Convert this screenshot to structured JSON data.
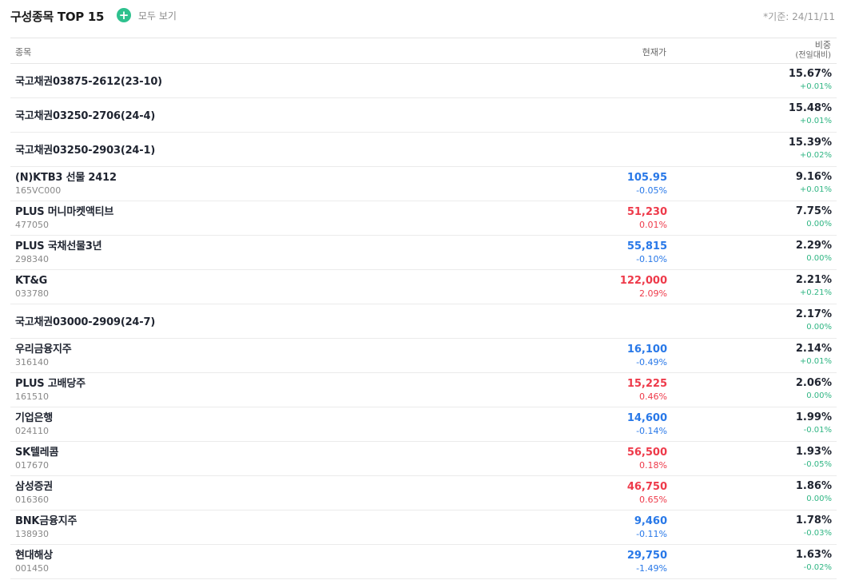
{
  "header": {
    "title": "구성종목 TOP 15",
    "view_all_label": "모두 보기",
    "basis": "*기준: 24/11/11",
    "accent_color": "#2ec18e"
  },
  "table": {
    "columns": {
      "name": "종목",
      "price": "현재가",
      "weight": "비중",
      "weight_sub": "(전일대비)"
    },
    "rows": [
      {
        "name": "국고채권03875-2612(23-10)",
        "code": "",
        "price": "",
        "price_change": "",
        "direction": "",
        "weight": "15.67%",
        "weight_change": "+0.01%"
      },
      {
        "name": "국고채권03250-2706(24-4)",
        "code": "",
        "price": "",
        "price_change": "",
        "direction": "",
        "weight": "15.48%",
        "weight_change": "+0.01%"
      },
      {
        "name": "국고채권03250-2903(24-1)",
        "code": "",
        "price": "",
        "price_change": "",
        "direction": "",
        "weight": "15.39%",
        "weight_change": "+0.02%"
      },
      {
        "name": "(N)KTB3 선물 2412",
        "code": "165VC000",
        "price": "105.95",
        "price_change": "-0.05%",
        "direction": "down",
        "weight": "9.16%",
        "weight_change": "+0.01%"
      },
      {
        "name": "PLUS 머니마켓액티브",
        "code": "477050",
        "price": "51,230",
        "price_change": "0.01%",
        "direction": "up",
        "weight": "7.75%",
        "weight_change": "0.00%"
      },
      {
        "name": "PLUS 국채선물3년",
        "code": "298340",
        "price": "55,815",
        "price_change": "-0.10%",
        "direction": "down",
        "weight": "2.29%",
        "weight_change": "0.00%"
      },
      {
        "name": "KT&G",
        "code": "033780",
        "price": "122,000",
        "price_change": "2.09%",
        "direction": "up",
        "weight": "2.21%",
        "weight_change": "+0.21%"
      },
      {
        "name": "국고채권03000-2909(24-7)",
        "code": "",
        "price": "",
        "price_change": "",
        "direction": "",
        "weight": "2.17%",
        "weight_change": "0.00%"
      },
      {
        "name": "우리금융지주",
        "code": "316140",
        "price": "16,100",
        "price_change": "-0.49%",
        "direction": "down",
        "weight": "2.14%",
        "weight_change": "+0.01%"
      },
      {
        "name": "PLUS 고배당주",
        "code": "161510",
        "price": "15,225",
        "price_change": "0.46%",
        "direction": "up",
        "weight": "2.06%",
        "weight_change": "0.00%"
      },
      {
        "name": "기업은행",
        "code": "024110",
        "price": "14,600",
        "price_change": "-0.14%",
        "direction": "down",
        "weight": "1.99%",
        "weight_change": "-0.01%"
      },
      {
        "name": "SK텔레콤",
        "code": "017670",
        "price": "56,500",
        "price_change": "0.18%",
        "direction": "up",
        "weight": "1.93%",
        "weight_change": "-0.05%"
      },
      {
        "name": "삼성증권",
        "code": "016360",
        "price": "46,750",
        "price_change": "0.65%",
        "direction": "up",
        "weight": "1.86%",
        "weight_change": "0.00%"
      },
      {
        "name": "BNK금융지주",
        "code": "138930",
        "price": "9,460",
        "price_change": "-0.11%",
        "direction": "down",
        "weight": "1.78%",
        "weight_change": "-0.03%"
      },
      {
        "name": "현대해상",
        "code": "001450",
        "price": "29,750",
        "price_change": "-1.49%",
        "direction": "down",
        "weight": "1.63%",
        "weight_change": "-0.02%"
      }
    ]
  },
  "colors": {
    "up": "#ee3a4a",
    "down": "#2878e8",
    "weight_change": "#2fb583"
  }
}
